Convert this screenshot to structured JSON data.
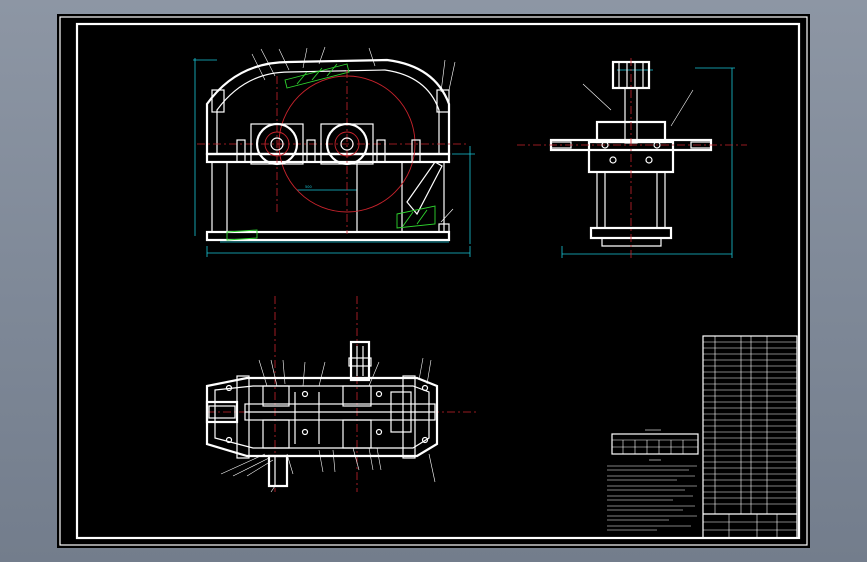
{
  "canvas": {
    "background": "#000000",
    "frame_color": "#ffffff"
  },
  "palette": {
    "outline": "#ffffff",
    "center_line": "#c8232c",
    "dimension": "#19c7d9",
    "section_hatch": "#2fd62f",
    "outer_backdrop": "#7e8897"
  },
  "views": [
    {
      "id": "front-view"
    },
    {
      "id": "side-view"
    },
    {
      "id": "top-section-view"
    }
  ],
  "tables": [
    {
      "id": "technical-characteristics-table"
    },
    {
      "id": "technical-requirements-notes"
    },
    {
      "id": "parts-list-and-title-block"
    }
  ]
}
